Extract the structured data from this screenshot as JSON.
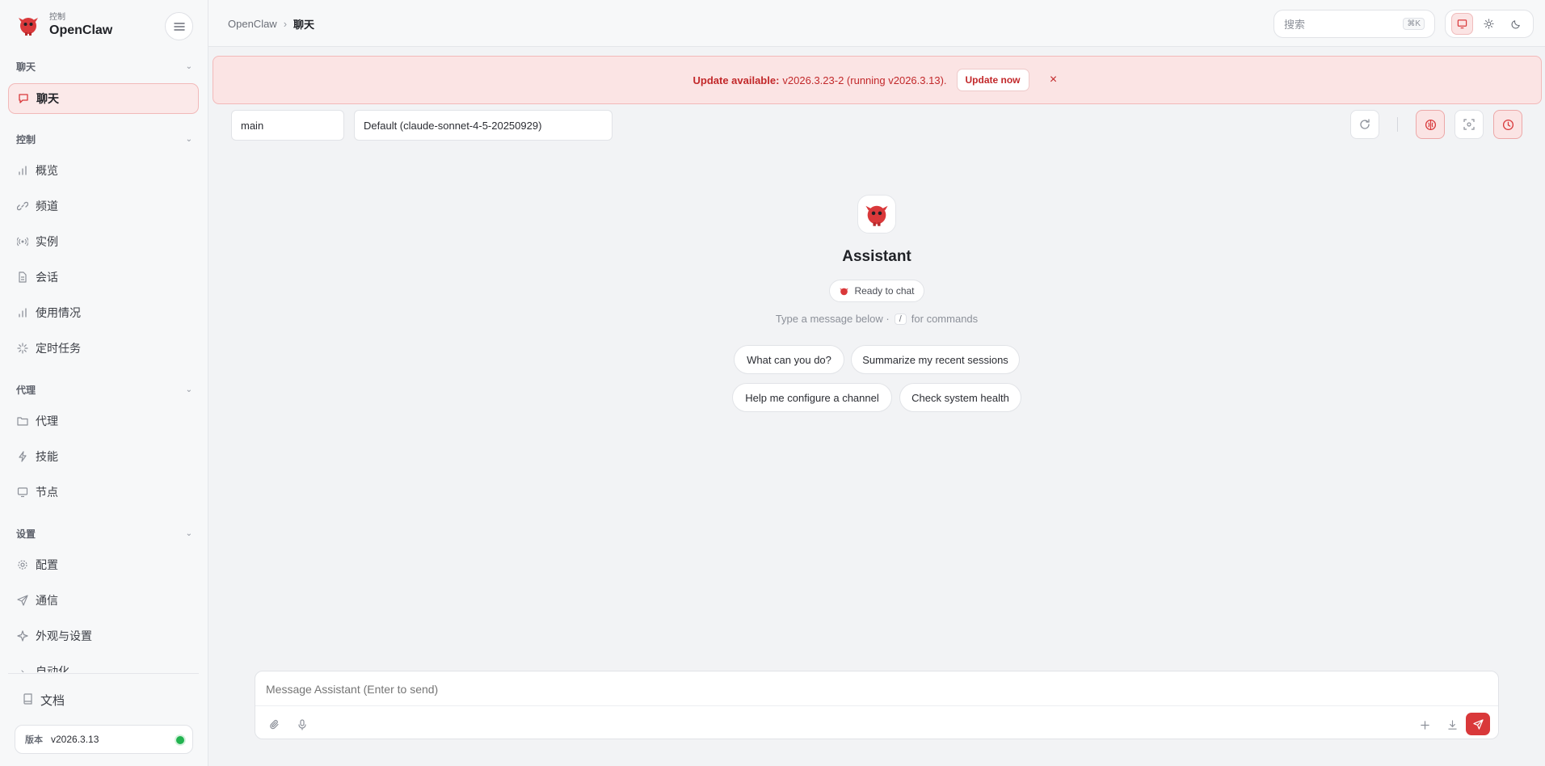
{
  "brand": {
    "eyebrow": "控制",
    "name": "OpenClaw"
  },
  "sidebar": {
    "sections": [
      {
        "label": "聊天",
        "items": [
          {
            "label": "聊天",
            "icon": "message-icon",
            "active": true
          }
        ]
      },
      {
        "label": "控制",
        "items": [
          {
            "label": "概览",
            "icon": "bar-chart-icon"
          },
          {
            "label": "频道",
            "icon": "link-icon"
          },
          {
            "label": "实例",
            "icon": "radio-icon"
          },
          {
            "label": "会话",
            "icon": "document-icon"
          },
          {
            "label": "使用情况",
            "icon": "bar-chart-icon"
          },
          {
            "label": "定时任务",
            "icon": "loader-icon"
          }
        ]
      },
      {
        "label": "代理",
        "items": [
          {
            "label": "代理",
            "icon": "folder-icon"
          },
          {
            "label": "技能",
            "icon": "zap-icon"
          },
          {
            "label": "节点",
            "icon": "monitor-icon"
          }
        ]
      },
      {
        "label": "设置",
        "items": [
          {
            "label": "配置",
            "icon": "gear-icon"
          },
          {
            "label": "通信",
            "icon": "send-icon"
          },
          {
            "label": "外观与设置",
            "icon": "sparkle-icon"
          },
          {
            "label": "自动化",
            "icon": "chevron-right-icon"
          }
        ]
      }
    ],
    "docs_label": "文档",
    "version_label": "版本",
    "version_value": "v2026.3.13",
    "status_color": "#22b350"
  },
  "topbar": {
    "breadcrumb_root": "OpenClaw",
    "breadcrumb_current": "聊天",
    "search_placeholder": "搜索",
    "search_shortcut": "⌘K",
    "theme_active": "system"
  },
  "banner": {
    "prefix": "Update available:",
    "version_text": "v2026.3.23-2 (running v2026.3.13).",
    "button": "Update now",
    "close": "×"
  },
  "controls": {
    "session_value": "main",
    "model_value": "Default (claude-sonnet-4-5-20250929)"
  },
  "welcome": {
    "title": "Assistant",
    "status": "Ready to chat",
    "hint_before": "Type a message below ·",
    "hint_key": "/",
    "hint_after": "for commands",
    "suggestions": [
      "What can you do?",
      "Summarize my recent sessions",
      "Help me configure a channel",
      "Check system health"
    ]
  },
  "composer": {
    "placeholder": "Message Assistant (Enter to send)"
  },
  "colors": {
    "accent": "#d9383a",
    "banner_bg": "#fbe4e4",
    "page_bg": "#f2f3f5"
  }
}
